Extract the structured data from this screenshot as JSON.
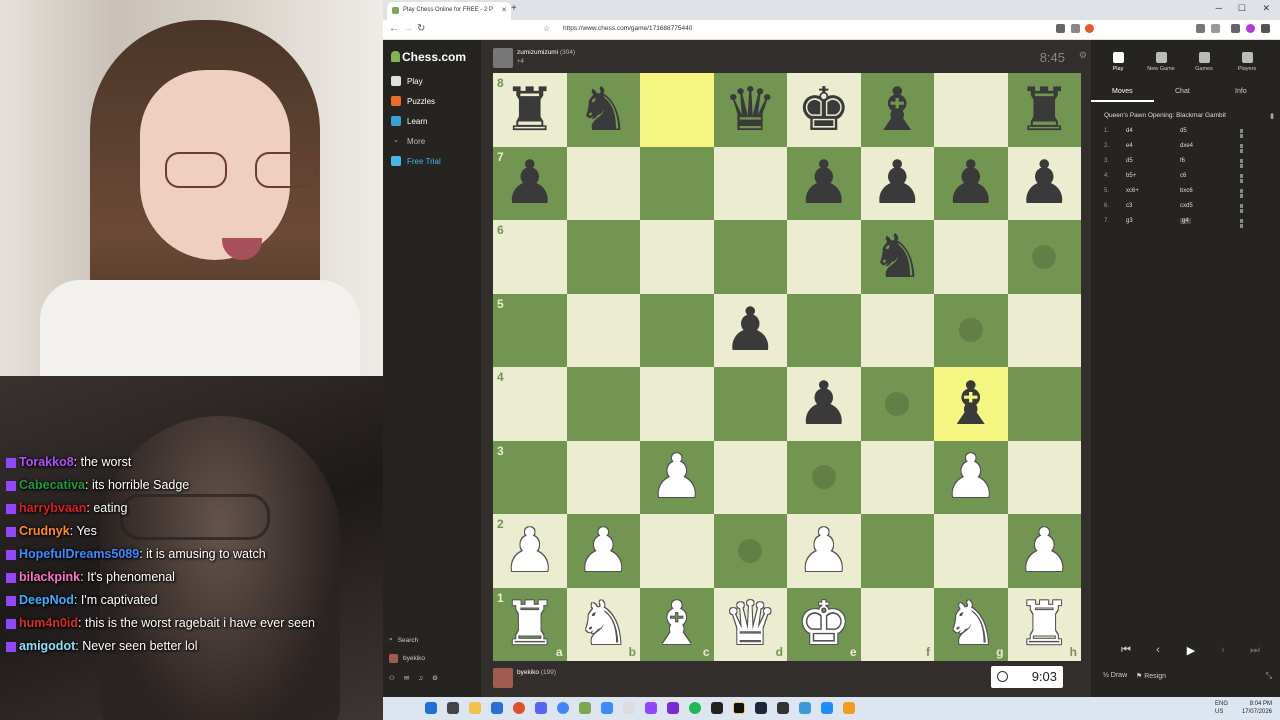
{
  "chat": [
    {
      "user": "Torakko8",
      "user_color": "#b34eff",
      "message": "the worst"
    },
    {
      "user": "Cabecativa",
      "user_color": "#1e9c3c",
      "message": "its horrible Sadge"
    },
    {
      "user": "harrybvaan",
      "user_color": "#d42020",
      "message": "eating"
    },
    {
      "user": "Crudnyk",
      "user_color": "#ff8c1a",
      "message": "Yes"
    },
    {
      "user": "HopefulDreams5089",
      "user_color": "#3a8cff",
      "message": "it is amusing to watch"
    },
    {
      "user": "bilackpink",
      "user_color": "#ff6ec7",
      "message": "It's phenomenal"
    },
    {
      "user": "DeepNod",
      "user_color": "#3ab0ff",
      "message": "I'm captivated"
    },
    {
      "user": "hum4n0id",
      "user_color": "#d43020",
      "message": "this is the worst ragebait i have ever seen"
    },
    {
      "user": "amigodot",
      "user_color": "#8be0ff",
      "message": "Never seen better lol"
    }
  ],
  "browser": {
    "tab_title": "Play Chess Online for FREE - 2 P",
    "url": "https://www.chess.com/game/171688775440"
  },
  "sidebar": {
    "logo": "Chess.com",
    "items": [
      {
        "label": "Play",
        "color": "#e0e0e0"
      },
      {
        "label": "Puzzles",
        "color": "#e86c2a"
      },
      {
        "label": "Learn",
        "color": "#3aa0d8"
      },
      {
        "label": "More",
        "color": "#777777"
      },
      {
        "label": "Free Trial",
        "color": "#44b8e8"
      }
    ],
    "search_label": "Search",
    "user_label": "byekiko"
  },
  "game": {
    "top_player": {
      "name": "zumizumizumi",
      "rating": "(304)",
      "sub": "+4"
    },
    "bottom_player": {
      "name": "byekiko",
      "rating": "(199)"
    },
    "clock_top": "8:45",
    "clock_bottom": "9:03",
    "files": [
      "a",
      "b",
      "c",
      "d",
      "e",
      "f",
      "g",
      "h"
    ],
    "ranks": [
      "8",
      "7",
      "6",
      "5",
      "4",
      "3",
      "2",
      "1"
    ],
    "board": [
      [
        "br",
        "bn",
        "",
        "bq",
        "bk",
        "bb",
        "",
        "br"
      ],
      [
        "bp",
        "",
        "",
        "",
        "bp",
        "bp",
        "bp",
        "bp"
      ],
      [
        "",
        "",
        "",
        "",
        "",
        "bn",
        "",
        ""
      ],
      [
        "",
        "",
        "",
        "bp",
        "",
        "",
        "",
        ""
      ],
      [
        "",
        "",
        "",
        "",
        "bp",
        "",
        "bb",
        ""
      ],
      [
        "",
        "",
        "wp",
        "",
        "",
        "",
        "wp",
        ""
      ],
      [
        "wp",
        "wp",
        "",
        "",
        "wp",
        "",
        "",
        "wp"
      ],
      [
        "wr",
        "wn",
        "wb",
        "wq",
        "wk",
        "",
        "wn",
        "wr"
      ]
    ],
    "highlights": [
      "c8",
      "g4"
    ],
    "move_dots": [
      "h6",
      "g5",
      "f4",
      "e3",
      "d2"
    ]
  },
  "panel": {
    "tabs": [
      "Play",
      "New Game",
      "Games",
      "Players"
    ],
    "subtabs": [
      "Moves",
      "Chat",
      "Info"
    ],
    "opening": "Queen's Pawn Opening: Blackmar Gambit",
    "moves": [
      {
        "num": "1.",
        "white": "d4",
        "black": "d5"
      },
      {
        "num": "2.",
        "white": "e4",
        "black": "dxe4"
      },
      {
        "num": "3.",
        "white": "d5",
        "black": "f6"
      },
      {
        "num": "4.",
        "white": "b5+",
        "black": "c6"
      },
      {
        "num": "5.",
        "white": "xc6+",
        "black": "bxc6"
      },
      {
        "num": "6.",
        "white": "c3",
        "black": "cxd5"
      },
      {
        "num": "7.",
        "white": "g3",
        "black": "g4"
      }
    ],
    "draw_label": "Draw",
    "resign_label": "Resign"
  },
  "taskbar": {
    "lang": "ENG\nUS",
    "time": "8:04 PM",
    "date": "17/07/2026"
  },
  "colors": {
    "board_light": "#ebecd0",
    "board_dark": "#739552",
    "highlight": "#f5f682",
    "accent": "#81b64c"
  }
}
